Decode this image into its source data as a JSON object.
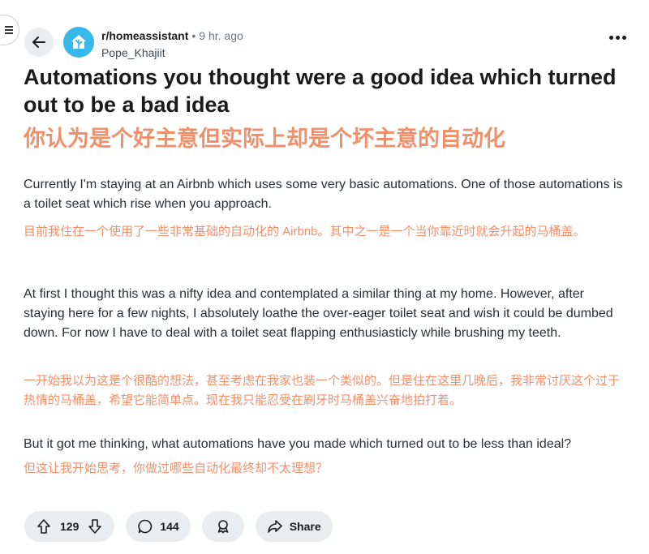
{
  "post": {
    "subreddit": "r/homeassistant",
    "separator": "•",
    "time": "9 hr. ago",
    "author": "Pope_Khajiit",
    "title": "Automations you thought were a good idea which turned out to be a bad idea",
    "title_zh": "你认为是个好主意但实际上却是个坏主意的自动化",
    "paragraphs": [
      {
        "en": "Currently I'm staying at an Airbnb which uses some very basic automations. One of those automations is a toilet seat which rise when you approach.",
        "zh": "目前我住在一个使用了一些非常基础的自动化的 Airbnb。其中之一是一个当你靠近时就会升起的马桶盖。"
      },
      {
        "en": "At first I thought this was a nifty idea and contemplated a similar thing at my home. However, after staying here for a few nights, I absolutely loathe the over-eager toilet seat and wish it could be dumbed down. For now I have to deal with a toilet seat flapping enthusiasticly while brushing my teeth.",
        "zh": "一开始我以为这是个很酷的想法，甚至考虑在我家也装一个类似的。但是住在这里几晚后，我非常讨厌这个过于热情的马桶盖，希望它能简单点。现在我只能忍受在刷牙时马桶盖兴奋地拍打着。"
      },
      {
        "en": "But it got me thinking, what automations have you made which turned out to be less than ideal?",
        "zh": "但这让我开始思考，你做过哪些自动化最终却不太理想？"
      }
    ]
  },
  "actions": {
    "votes": "129",
    "comments": "144",
    "share_label": "Share"
  },
  "icons": {
    "menu": "hamburger-menu-icon",
    "back": "arrow-left-icon",
    "subreddit": "home-assistant-logo",
    "more": "more-horizontal-icon",
    "upvote": "arrow-up-icon",
    "downvote": "arrow-down-icon",
    "comment": "comment-bubble-icon",
    "award": "award-icon",
    "share": "share-arrow-icon"
  },
  "colors": {
    "translation": "#f0906b",
    "subreddit_icon": "#38b8ea",
    "pill_bg": "#eaedef"
  }
}
